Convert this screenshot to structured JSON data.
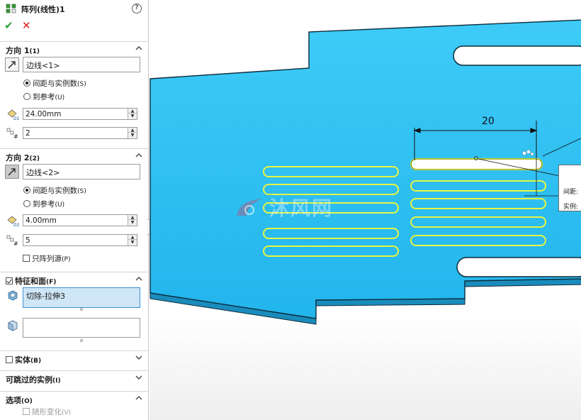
{
  "panel": {
    "title": "阵列(线性)1",
    "feature_icon": "linear-pattern-icon",
    "help_icon": "help-icon",
    "ok_icon": "check-mark-icon",
    "cancel_icon": "x-mark-icon",
    "direction1": {
      "header": "方向 1",
      "header_sub": "(1)",
      "edge_value": "边线<1>",
      "radio_spacing": "间距与实例数",
      "radio_spacing_sub": "(S)",
      "radio_reference": "到参考",
      "radio_reference_sub": "(U)",
      "selected_radio": "spacing",
      "spacing_value": "24.00mm",
      "instances_value": "2"
    },
    "direction2": {
      "header": "方向 2",
      "header_sub": "(2)",
      "edge_value": "边线<2>",
      "radio_spacing": "间距与实例数",
      "radio_spacing_sub": "(S)",
      "radio_reference": "到参考",
      "radio_reference_sub": "(U)",
      "selected_radio": "spacing",
      "spacing_value": "4.00mm",
      "instances_value": "5",
      "pattern_seed_only": "只阵列源",
      "pattern_seed_only_sub": "(P)",
      "pattern_seed_only_checked": false
    },
    "features": {
      "header": "特征和面",
      "header_sub": "(F)",
      "checked": true,
      "features_value": "切除-拉伸3",
      "faces_value": ""
    },
    "bodies": {
      "header": "实体",
      "header_sub": "(B)",
      "checked": false
    },
    "skip": {
      "header": "可跳过的实例",
      "header_sub": "(I)"
    },
    "options": {
      "header": "选项",
      "header_sub": "(O)",
      "vary_sketch": "随形变化",
      "vary_sketch_sub": "(V)",
      "vary_sketch_checked": false
    }
  },
  "viewport": {
    "dimension_value": "20",
    "callout_line1": "间距:",
    "callout_line2": "实例:",
    "watermark": "沐风网",
    "part_color": "#2fc2f5",
    "slot_highlight_color": "#e6f542"
  }
}
